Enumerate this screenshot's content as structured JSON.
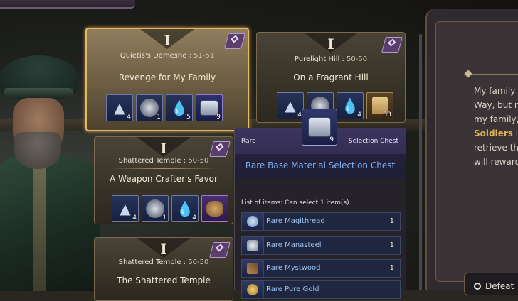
{
  "cards": [
    {
      "numeral": "I",
      "location": "Quietis's Demesne",
      "level": "51-51",
      "name": "Revenge for My Family",
      "rewards": [
        {
          "icon": "crystal-icon",
          "count": "4"
        },
        {
          "icon": "gear-orb-icon",
          "count": "1"
        },
        {
          "icon": "water-drop-icon",
          "count": "5"
        },
        {
          "icon": "selection-chest-icon",
          "count": "9"
        }
      ]
    },
    {
      "numeral": "I",
      "location": "Purelight Hill",
      "level": "50-50",
      "name": "On a Fragrant Hill",
      "rewards": [
        {
          "icon": "crystal-icon",
          "count": "4"
        },
        {
          "icon": "gear-orb-icon",
          "count": ""
        },
        {
          "icon": "water-drop-icon",
          "count": "4"
        },
        {
          "icon": "scroll-icon",
          "count": "33"
        }
      ]
    },
    {
      "numeral": "I",
      "location": "Shattered Temple",
      "level": "50-50",
      "name": "A Weapon Crafter's Favor",
      "rewards": [
        {
          "icon": "crystal-icon",
          "count": "4"
        },
        {
          "icon": "gear-orb-icon",
          "count": "1"
        },
        {
          "icon": "water-drop-icon",
          "count": "4"
        },
        {
          "icon": "ore-icon",
          "count": ""
        }
      ]
    },
    {
      "numeral": "I",
      "location": "Shattered Temple",
      "level": "50-50",
      "name": "The Shattered Temple",
      "rewards": []
    }
  ],
  "floating_item": {
    "count": "9"
  },
  "tooltip": {
    "rarity": "Rare",
    "type": "Selection Chest",
    "name": "Rare Base Material Selection Chest",
    "list_title": "List of items: Can select 1 item(s)",
    "items": [
      {
        "name": "Rare Magithread",
        "qty": "1"
      },
      {
        "name": "Rare Manasteel",
        "qty": "1"
      },
      {
        "name": "Rare Mystwood",
        "qty": "1"
      },
      {
        "name": "Rare Pure Gold",
        "qty": ""
      }
    ]
  },
  "story": {
    "line1": "My family t",
    "line2": "Way, but re",
    "line3": "my family,",
    "line4_gold": "Soldiers",
    "line4_rest": " in",
    "line5": "retrieve the",
    "line6": "will reward"
  },
  "defeat_label": "Defeat"
}
